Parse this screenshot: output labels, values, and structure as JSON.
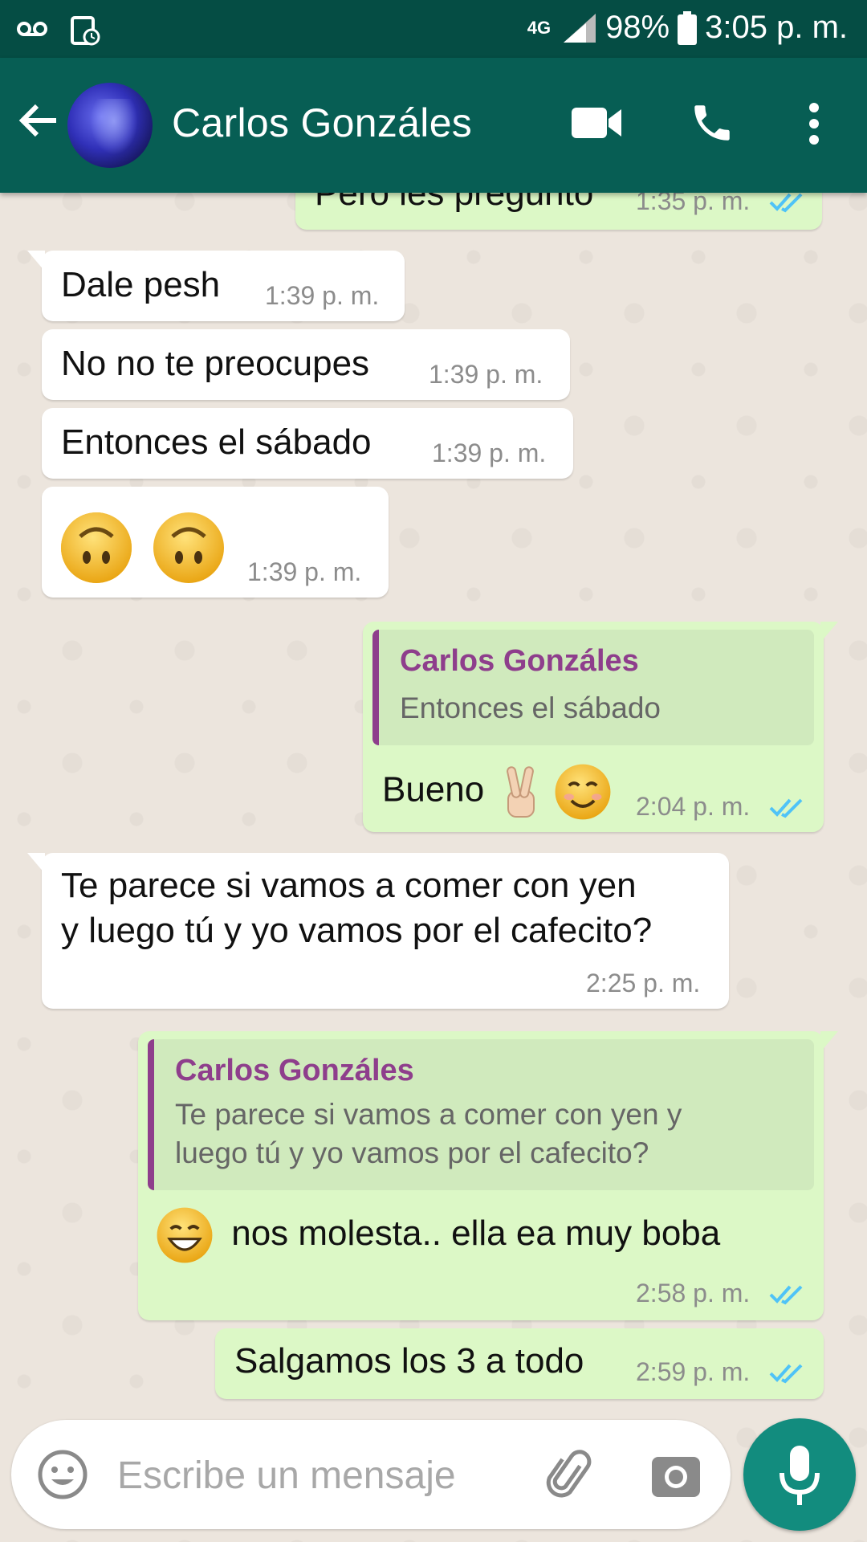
{
  "status_bar": {
    "network": "4G",
    "battery": "98%",
    "time": "3:05 p. m."
  },
  "header": {
    "contact_name": "Carlos Gonzáles"
  },
  "messages": [
    {
      "text": "Pero les pregunto",
      "time": "1:35 p. m."
    },
    {
      "text": "Dale pesh",
      "time": "1:39 p. m."
    },
    {
      "text": "No no te preocupes",
      "time": "1:39 p. m."
    },
    {
      "text": "Entonces el sábado",
      "time": "1:39 p. m."
    },
    {
      "text": "🙃🙃",
      "time": "1:39 p. m."
    },
    {
      "quote_name": "Carlos Gonzáles",
      "quote_text": "Entonces el sábado",
      "text": "Bueno",
      "time": "2:04 p. m."
    },
    {
      "line1": "Te parece si vamos a comer con yen",
      "line2": "y luego tú y yo vamos por el cafecito?",
      "time": "2:25 p. m."
    },
    {
      "quote_name": "Carlos Gonzáles",
      "quote_text": "Te parece si vamos a comer con yen y\nluego tú y yo vamos por el cafecito?",
      "text": "nos molesta.. ella ea muy boba",
      "time": "2:58 p. m."
    },
    {
      "text": "Salgamos los 3 a todo",
      "time": "2:59 p. m."
    }
  ],
  "composer": {
    "placeholder": "Escribe un mensaje"
  },
  "colors": {
    "header": "#075e54",
    "status_bar": "#054d44",
    "outgoing_bubble": "#dcf8c6",
    "incoming_bubble": "#ffffff",
    "read_ticks": "#4fc3f7",
    "quote_accent": "#8e3e8c",
    "mic_button": "#128c7e"
  }
}
